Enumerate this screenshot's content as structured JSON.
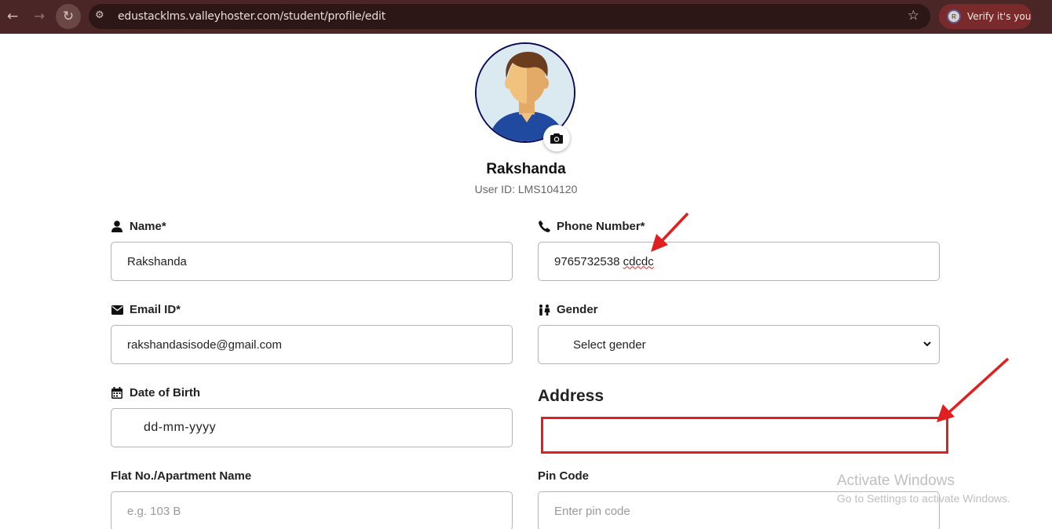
{
  "browser": {
    "url": "edustacklms.valleyhoster.com/student/profile/edit",
    "verify_label": "Verify it's you",
    "profile_initial": "R"
  },
  "profile": {
    "name": "Rakshanda",
    "user_id": "User ID: LMS104120"
  },
  "form": {
    "name": {
      "label": "Name*",
      "value": "Rakshanda"
    },
    "phone": {
      "label": "Phone Number*",
      "value_main": "9765732538 ",
      "value_misspelled": "cdcdc"
    },
    "email": {
      "label": "Email ID*",
      "value": "rakshandasisode@gmail.com"
    },
    "gender": {
      "label": "Gender",
      "value": "Select gender"
    },
    "dob": {
      "label": "Date of Birth",
      "placeholder": "dd-mm-yyyy"
    },
    "address_heading": "Address",
    "flat": {
      "label": "Flat No./Apartment Name",
      "placeholder": "e.g. 103 B"
    },
    "pincode": {
      "label": "Pin Code",
      "placeholder": "Enter pin code"
    }
  },
  "watermark": {
    "title": "Activate Windows",
    "subtitle": "Go to Settings to activate Windows."
  },
  "colors": {
    "chrome_bg": "#4a2726",
    "annotation_red": "#e02020",
    "avatar_border": "#0b0b5a"
  },
  "icons": [
    "back-arrow-icon",
    "forward-arrow-icon",
    "reload-icon",
    "site-settings-icon",
    "bookmark-star-icon",
    "camera-icon",
    "user-icon",
    "phone-icon",
    "envelope-icon",
    "gender-icon",
    "calendar-icon",
    "chevron-down-icon"
  ]
}
